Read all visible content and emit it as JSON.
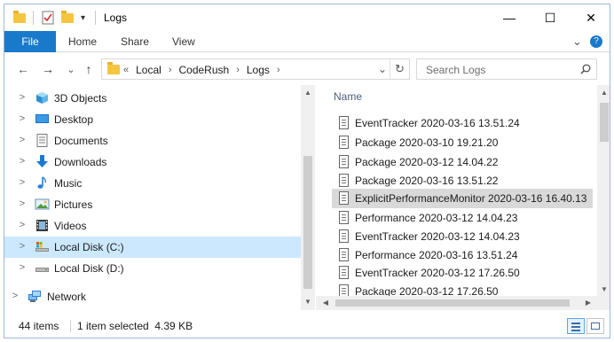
{
  "window": {
    "title": "Logs"
  },
  "titlebar": {
    "minimize": "—",
    "maximize": "☐",
    "close": "✕"
  },
  "ribbon": {
    "tabs": [
      "File",
      "Home",
      "Share",
      "View"
    ],
    "help": "?",
    "expand": "⌄"
  },
  "nav": {
    "back": "←",
    "forward": "→",
    "recent": "⌄",
    "up": "↑",
    "breadcrumb": [
      "«",
      "Local",
      "›",
      "CodeRush",
      "›",
      "Logs",
      "›"
    ],
    "addr_dropdown": "⌄",
    "refresh": "↻",
    "search_placeholder": "Search Logs",
    "search_icon": "search-icon"
  },
  "tree": [
    {
      "label": "3D Objects",
      "icon": "3d-objects-icon",
      "arrow": ">"
    },
    {
      "label": "Desktop",
      "icon": "desktop-icon",
      "arrow": ">"
    },
    {
      "label": "Documents",
      "icon": "documents-icon",
      "arrow": ">"
    },
    {
      "label": "Downloads",
      "icon": "downloads-icon",
      "arrow": ">"
    },
    {
      "label": "Music",
      "icon": "music-icon",
      "arrow": ">"
    },
    {
      "label": "Pictures",
      "icon": "pictures-icon",
      "arrow": ">"
    },
    {
      "label": "Videos",
      "icon": "videos-icon",
      "arrow": ">"
    },
    {
      "label": "Local Disk (C:)",
      "icon": "drive-c-icon",
      "arrow": ">"
    },
    {
      "label": "Local Disk (D:)",
      "icon": "drive-d-icon",
      "arrow": ">"
    },
    {
      "label": "Network",
      "icon": "network-icon",
      "arrow": ">"
    }
  ],
  "content": {
    "column_header": "Name",
    "files": [
      "EventTracker 2020-03-16 13.51.24",
      "Package 2020-03-10 19.21.20",
      "Package 2020-03-12 14.04.22",
      "Package 2020-03-16 13.51.22",
      "ExplicitPerformanceMonitor 2020-03-16 16.40.13",
      "Performance 2020-03-12 14.04.23",
      "EventTracker 2020-03-12 14.04.23",
      "Performance 2020-03-16 13.51.24",
      "EventTracker 2020-03-12 17.26.50",
      "Package 2020-03-12 17.26.50"
    ]
  },
  "status": {
    "item_count": "44 items",
    "selection": "1 item selected  4.39 KB"
  },
  "colors": {
    "accent": "#1979ca",
    "nav_selection": "#cce8ff",
    "row_selection": "#d9d9d9",
    "folder": "#f5c542"
  }
}
